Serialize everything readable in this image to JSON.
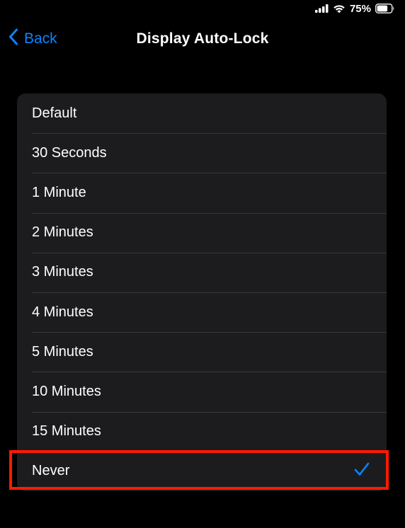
{
  "status_bar": {
    "battery_percent": "75%",
    "icons": [
      "cellular-signal-icon",
      "wifi-icon",
      "battery-icon"
    ]
  },
  "nav": {
    "back_label": "Back",
    "title": "Display Auto-Lock"
  },
  "options": [
    {
      "label": "Default",
      "selected": false
    },
    {
      "label": "30 Seconds",
      "selected": false
    },
    {
      "label": "1 Minute",
      "selected": false
    },
    {
      "label": "2 Minutes",
      "selected": false
    },
    {
      "label": "3 Minutes",
      "selected": false
    },
    {
      "label": "4 Minutes",
      "selected": false
    },
    {
      "label": "5 Minutes",
      "selected": false
    },
    {
      "label": "10 Minutes",
      "selected": false
    },
    {
      "label": "15 Minutes",
      "selected": false
    },
    {
      "label": "Never",
      "selected": true
    }
  ],
  "colors": {
    "accent": "#0a84ff",
    "highlight_border": "#ff1a00",
    "list_background": "#1c1c1e",
    "separator": "#38383a",
    "background": "#000000"
  }
}
